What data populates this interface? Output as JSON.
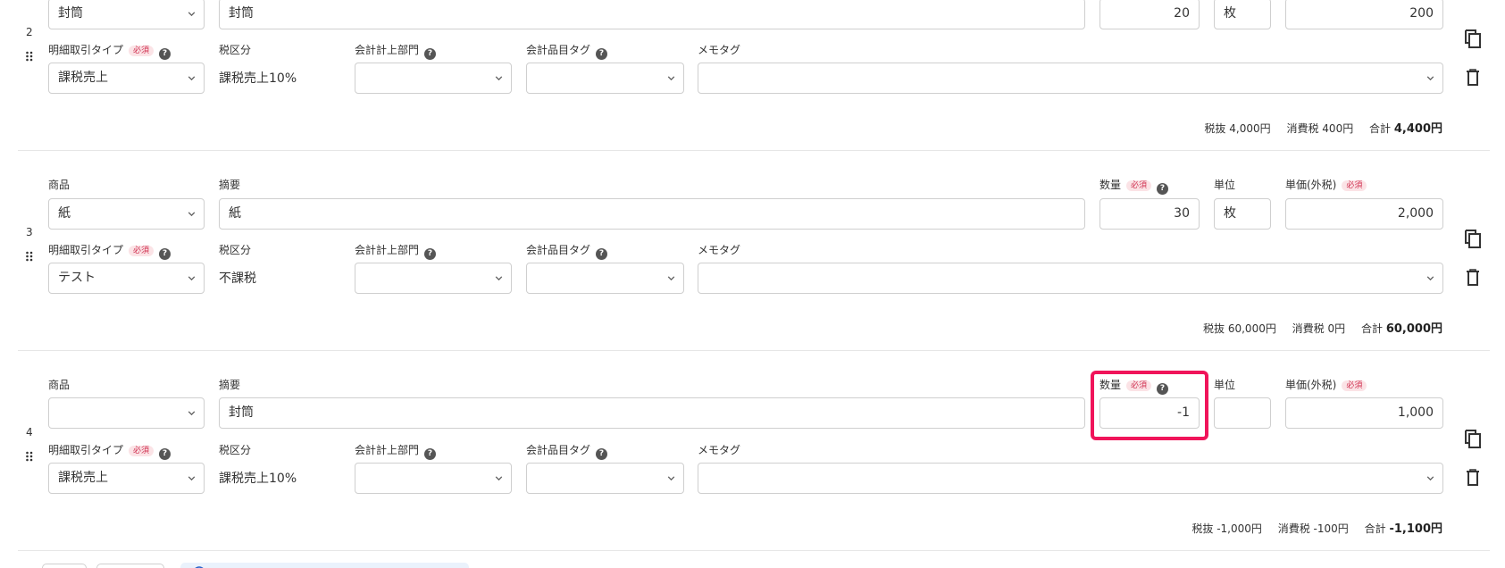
{
  "labels": {
    "product": "商品",
    "description": "摘要",
    "quantity": "数量",
    "unit": "単位",
    "unit_price": "単価(外税)",
    "line_type": "明細取引タイプ",
    "tax_category": "税区分",
    "department": "会計計上部門",
    "item_tag": "会計品目タグ",
    "memo_tag": "メモタグ",
    "required": "必須",
    "help": "?",
    "excl_tax": "税抜",
    "consumption_tax": "消費税",
    "total": "合計"
  },
  "rows": [
    {
      "number": "2",
      "product": "封筒",
      "description": "封筒",
      "quantity": "20",
      "unit": "枚",
      "unit_price": "200",
      "line_type": "課税売上",
      "tax_category": "課税売上10%",
      "excl_tax": "4,000円",
      "consumption_tax": "400円",
      "total": "4,400円"
    },
    {
      "number": "3",
      "product": "紙",
      "description": "紙",
      "quantity": "30",
      "unit": "枚",
      "unit_price": "2,000",
      "line_type": "テスト",
      "tax_category": "不課税",
      "excl_tax": "60,000円",
      "consumption_tax": "0円",
      "total": "60,000円"
    },
    {
      "number": "4",
      "product": "",
      "description": "封筒",
      "quantity": "-1",
      "unit": "",
      "unit_price": "1,000",
      "line_type": "課税売上",
      "tax_category": "課税売上10%",
      "excl_tax": "-1,000円",
      "consumption_tax": "-100円",
      "total": "-1,100円"
    }
  ],
  "colors": {
    "highlight": "#f0145a",
    "required_bg": "#fbe3e6",
    "required_text": "#d03050",
    "border": "#cfcfcf"
  },
  "icons": {
    "copy": "copy-icon",
    "delete": "trash-icon",
    "drag": "drag-handle-icon",
    "dropdown": "chevron-down-icon",
    "help": "help-circle-icon"
  }
}
